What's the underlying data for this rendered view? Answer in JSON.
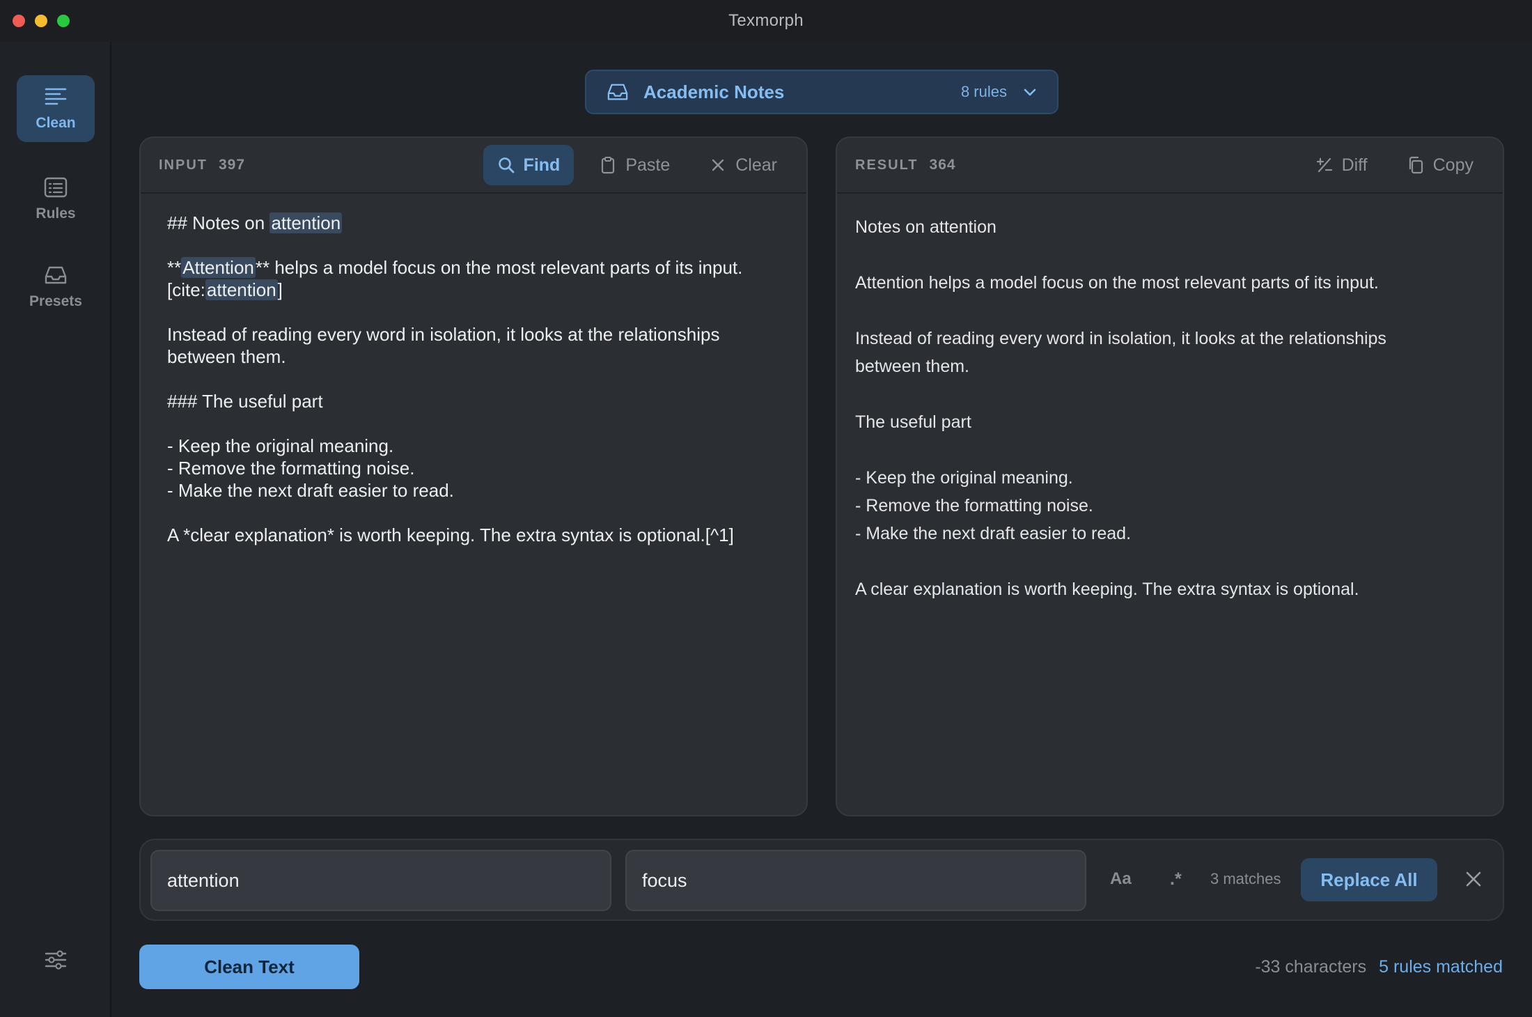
{
  "window": {
    "title": "Texmorph"
  },
  "sidebar": {
    "items": [
      {
        "label": "Clean",
        "icon": "lines-icon",
        "active": true
      },
      {
        "label": "Rules",
        "icon": "list-icon",
        "active": false
      },
      {
        "label": "Presets",
        "icon": "inbox-icon",
        "active": false
      }
    ],
    "settings_icon": "sliders-icon"
  },
  "preset": {
    "name": "Academic Notes",
    "count": "8 rules"
  },
  "input": {
    "label": "INPUT",
    "count": "397",
    "actions": {
      "find": "Find",
      "paste": "Paste",
      "clear": "Clear"
    },
    "paragraphs": [
      [
        {
          "t": "## Notes on "
        },
        {
          "t": "attention",
          "hl": true
        }
      ],
      [
        {
          "t": "**"
        },
        {
          "t": "Attention",
          "hl": true
        },
        {
          "t": "** helps a model focus on the most relevant parts of its input.\n[cite:"
        },
        {
          "t": "attention",
          "hl": true
        },
        {
          "t": "]"
        }
      ],
      [
        {
          "t": "Instead of reading every word in isolation, it looks at the relationships\nbetween them."
        }
      ],
      [
        {
          "t": "### The useful part"
        }
      ],
      [
        {
          "t": "- Keep the original meaning.\n- Remove the formatting noise.\n- Make the next draft easier to read."
        }
      ],
      [
        {
          "t": "A *clear explanation* is worth keeping. The extra syntax is optional.[^1]"
        }
      ]
    ]
  },
  "result": {
    "label": "RESULT",
    "count": "364",
    "actions": {
      "diff": "Diff",
      "copy": "Copy"
    },
    "paragraphs": [
      "Notes on attention",
      "Attention helps a model focus on the most relevant parts of its input.",
      "Instead of reading every word in isolation, it looks at the relationships\nbetween them.",
      "The useful part",
      "- Keep the original meaning.\n- Remove the formatting noise.\n- Make the next draft easier to read.",
      "A clear explanation is worth keeping. The extra syntax is optional."
    ]
  },
  "findbar": {
    "find_value": "attention",
    "replace_value": "focus",
    "case_label": "Aa",
    "regex_label": ".*",
    "matches": "3 matches",
    "replace_all": "Replace All"
  },
  "footer": {
    "clean_button": "Clean Text",
    "chars": "-33 characters",
    "rules_matched": "5 rules matched"
  },
  "colors": {
    "accent": "#61a4e6",
    "accent_dim": "#2b4662",
    "highlight": "#3a4a5e",
    "panel": "#2b2e33",
    "background": "#1d2025"
  }
}
